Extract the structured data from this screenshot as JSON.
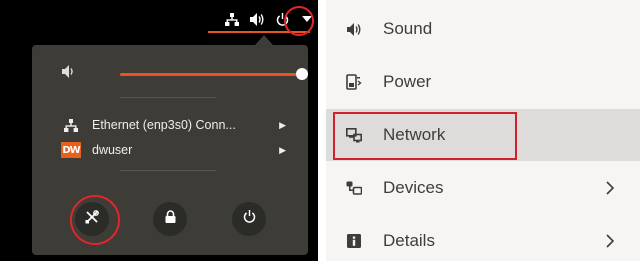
{
  "system_menu": {
    "volume": {
      "level": 0.97,
      "accent_color": "#e95420"
    },
    "items": [
      {
        "label": "Ethernet (enp3s0) Conn...",
        "icon": "network-wired-icon",
        "has_submenu": true
      },
      {
        "label": "dwuser",
        "icon": "dw-logo",
        "logo_text": "DW",
        "has_submenu": true
      }
    ],
    "buttons": [
      {
        "name": "settings",
        "icon": "settings-icon"
      },
      {
        "name": "lock",
        "icon": "lock-icon"
      },
      {
        "name": "power-off",
        "icon": "power-icon"
      }
    ],
    "topbar_icons": [
      "network-icon",
      "volume-icon",
      "power-icon",
      "dropdown-arrow-icon"
    ],
    "annotation_color": "#e3262a"
  },
  "settings_sidebar": {
    "items": [
      {
        "label": "Sound",
        "icon": "sound-icon",
        "selected": false,
        "has_arrow": false
      },
      {
        "label": "Power",
        "icon": "power-icon",
        "selected": false,
        "has_arrow": false
      },
      {
        "label": "Network",
        "icon": "network-icon",
        "selected": true,
        "has_arrow": false
      },
      {
        "label": "Devices",
        "icon": "devices-icon",
        "selected": false,
        "has_arrow": true
      },
      {
        "label": "Details",
        "icon": "details-icon",
        "selected": false,
        "has_arrow": true
      }
    ],
    "selected_background": "#dedcda",
    "annotation_color": "#d4202c"
  }
}
